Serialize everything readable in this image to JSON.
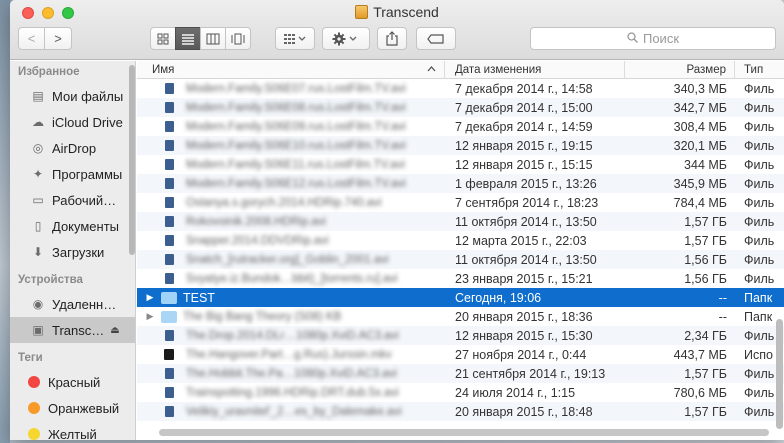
{
  "window": {
    "title": "Transcend"
  },
  "toolbar": {
    "back_symbol": "<",
    "forward_symbol": ">",
    "search_placeholder": "Поиск"
  },
  "sidebar": {
    "favorites_label": "Избранное",
    "favorites": [
      {
        "label": "Мои файлы",
        "icon": "all-my-files-icon"
      },
      {
        "label": "iCloud Drive",
        "icon": "cloud-icon"
      },
      {
        "label": "AirDrop",
        "icon": "airdrop-icon"
      },
      {
        "label": "Программы",
        "icon": "applications-icon"
      },
      {
        "label": "Рабочий…",
        "icon": "desktop-icon"
      },
      {
        "label": "Документы",
        "icon": "documents-icon"
      },
      {
        "label": "Загрузки",
        "icon": "downloads-icon"
      }
    ],
    "devices_label": "Устройства",
    "devices": [
      {
        "label": "Удаленн…",
        "icon": "remote-disc-icon"
      },
      {
        "label": "Transc…",
        "icon": "external-drive-icon",
        "selected": true
      }
    ],
    "tags_label": "Теги",
    "tags": [
      {
        "label": "Красный",
        "color": "#f24640"
      },
      {
        "label": "Оранжевый",
        "color": "#f79a2a"
      },
      {
        "label": "Желтый",
        "color": "#f6d630"
      }
    ]
  },
  "columns": {
    "name": "Имя",
    "date": "Дата изменения",
    "size": "Размер",
    "kind": "Тип"
  },
  "files": [
    {
      "name": "Modern.Family.S06E07.rus.LostFilm.TV.avi",
      "date": "7 декабря 2014 г., 14:58",
      "size": "340,3 МБ",
      "kind": "Филь",
      "type": "file"
    },
    {
      "name": "Modern.Family.S06E08.rus.LostFilm.TV.avi",
      "date": "7 декабря 2014 г., 15:00",
      "size": "342,7 МБ",
      "kind": "Филь",
      "type": "file"
    },
    {
      "name": "Modern.Family.S06E09.rus.LostFilm.TV.avi",
      "date": "7 декабря 2014 г., 14:59",
      "size": "308,4 МБ",
      "kind": "Филь",
      "type": "file"
    },
    {
      "name": "Modern.Family.S06E10.rus.LostFilm.TV.avi",
      "date": "12 января 2015 г., 19:15",
      "size": "320,1 МБ",
      "kind": "Филь",
      "type": "file"
    },
    {
      "name": "Modern.Family.S06E11.rus.LostFilm.TV.avi",
      "date": "12 января 2015 г., 15:15",
      "size": "344 МБ",
      "kind": "Филь",
      "type": "file"
    },
    {
      "name": "Modern.Family.S06E12.rus.LostFilm.TV.avi",
      "date": "1 февраля 2015 г., 13:26",
      "size": "345,9 МБ",
      "kind": "Филь",
      "type": "file"
    },
    {
      "name": "Ostanya.s.gorych.2014.HDRip.740.avi",
      "date": "7 сентября 2014 г., 18:23",
      "size": "784,4 МБ",
      "kind": "Филь",
      "type": "file"
    },
    {
      "name": "Rokovoinik.2008.HDRip.avi",
      "date": "11 октября 2014 г., 13:50",
      "size": "1,57 ГБ",
      "kind": "Филь",
      "type": "file"
    },
    {
      "name": "Snapper.2014.DDVDRip.avi",
      "date": "12 марта 2015 г., 22:03",
      "size": "1,57 ГБ",
      "kind": "Филь",
      "type": "file"
    },
    {
      "name": "Snatch_[rutracker.org]_Goblin_2001.avi",
      "date": "11 октября 2014 г., 13:50",
      "size": "1,56 ГБ",
      "kind": "Филь",
      "type": "file"
    },
    {
      "name": "Svyatye.iz.Bundok…bbit)_[torrents.ru].avi",
      "date": "23 января 2015 г., 15:21",
      "size": "1,56 ГБ",
      "kind": "Филь",
      "type": "file"
    },
    {
      "name": "TEST",
      "date": "Сегодня, 19:06",
      "size": "--",
      "kind": "Папк",
      "type": "folder",
      "selected": true
    },
    {
      "name": "The Big Bang Theory (S08) KB",
      "date": "20 января 2015 г., 18:36",
      "size": "--",
      "kind": "Папк",
      "type": "folder"
    },
    {
      "name": "The.Drop.2014.DLr…1080p.XviD.AC3.avi",
      "date": "12 января 2015 г., 15:30",
      "size": "2,34 ГБ",
      "kind": "Филь",
      "type": "file"
    },
    {
      "name": "The.Hangover.Part…g.Rus).Jurssin.mkv",
      "date": "27 ноября 2014 г., 0:44",
      "size": "443,7 МБ",
      "kind": "Испо",
      "type": "video"
    },
    {
      "name": "The.Hobbit.The.Pa…1080p.XviD.AC3.avi",
      "date": "21 сентября 2014 г., 19:13",
      "size": "1,57 ГБ",
      "kind": "Филь",
      "type": "file"
    },
    {
      "name": "Trainspotting.1996.HDRip.DRT.dub.5x.avi",
      "date": "24 июля 2014 г., 1:15",
      "size": "780,6 МБ",
      "kind": "Филь",
      "type": "file"
    },
    {
      "name": "Velikiy_uravnitel'_2…es_by_Dalemake.avi",
      "date": "20 января 2015 г., 18:48",
      "size": "1,57 ГБ",
      "kind": "Филь",
      "type": "file"
    }
  ]
}
